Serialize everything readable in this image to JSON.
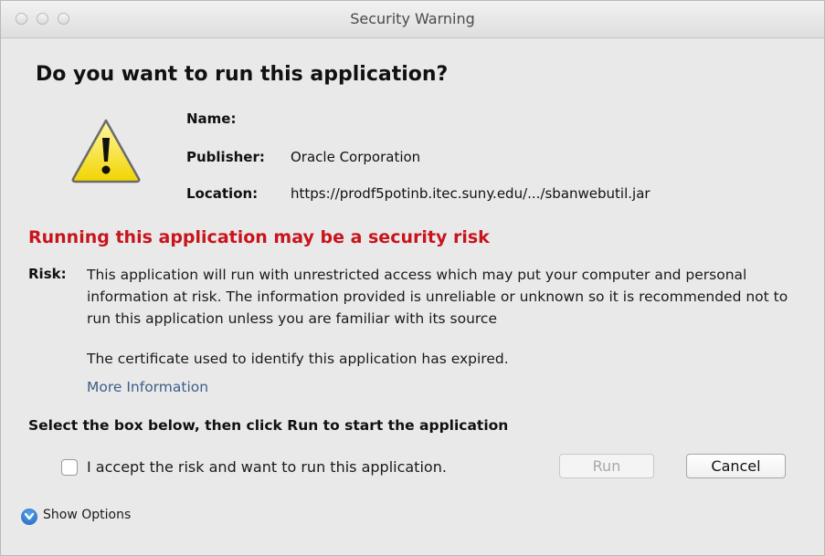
{
  "window": {
    "title": "Security Warning"
  },
  "dialog": {
    "heading": "Do you want to run this application?",
    "name_label": "Name:",
    "name_value": "",
    "publisher_label": "Publisher:",
    "publisher_value": "Oracle Corporation",
    "location_label": "Location:",
    "location_value": "https://prodf5potinb.itec.suny.edu/.../sbanwebutil.jar",
    "risk_title": "Running this application may be a security risk",
    "risk_label": "Risk:",
    "risk_text": "This application will run with unrestricted access which may put your computer and personal information at risk. The information provided is unreliable or unknown so it is recommended not to run this application unless you are familiar with its source",
    "cert_text": "The certificate used to identify this application has expired.",
    "more_info_link": "More Information",
    "select_instruction": "Select the box below, then click Run to start the application",
    "accept_checkbox_label": "I accept the risk and want to run this application.",
    "accept_checked": false,
    "run_button": "Run",
    "cancel_button": "Cancel",
    "show_options": "Show Options"
  },
  "icons": {
    "warning": "warning-triangle-icon",
    "options": "chevron-down-circle-icon"
  },
  "colors": {
    "risk_title": "#c8141c",
    "link": "#3c5f86",
    "options_icon": "#2a74cc"
  }
}
